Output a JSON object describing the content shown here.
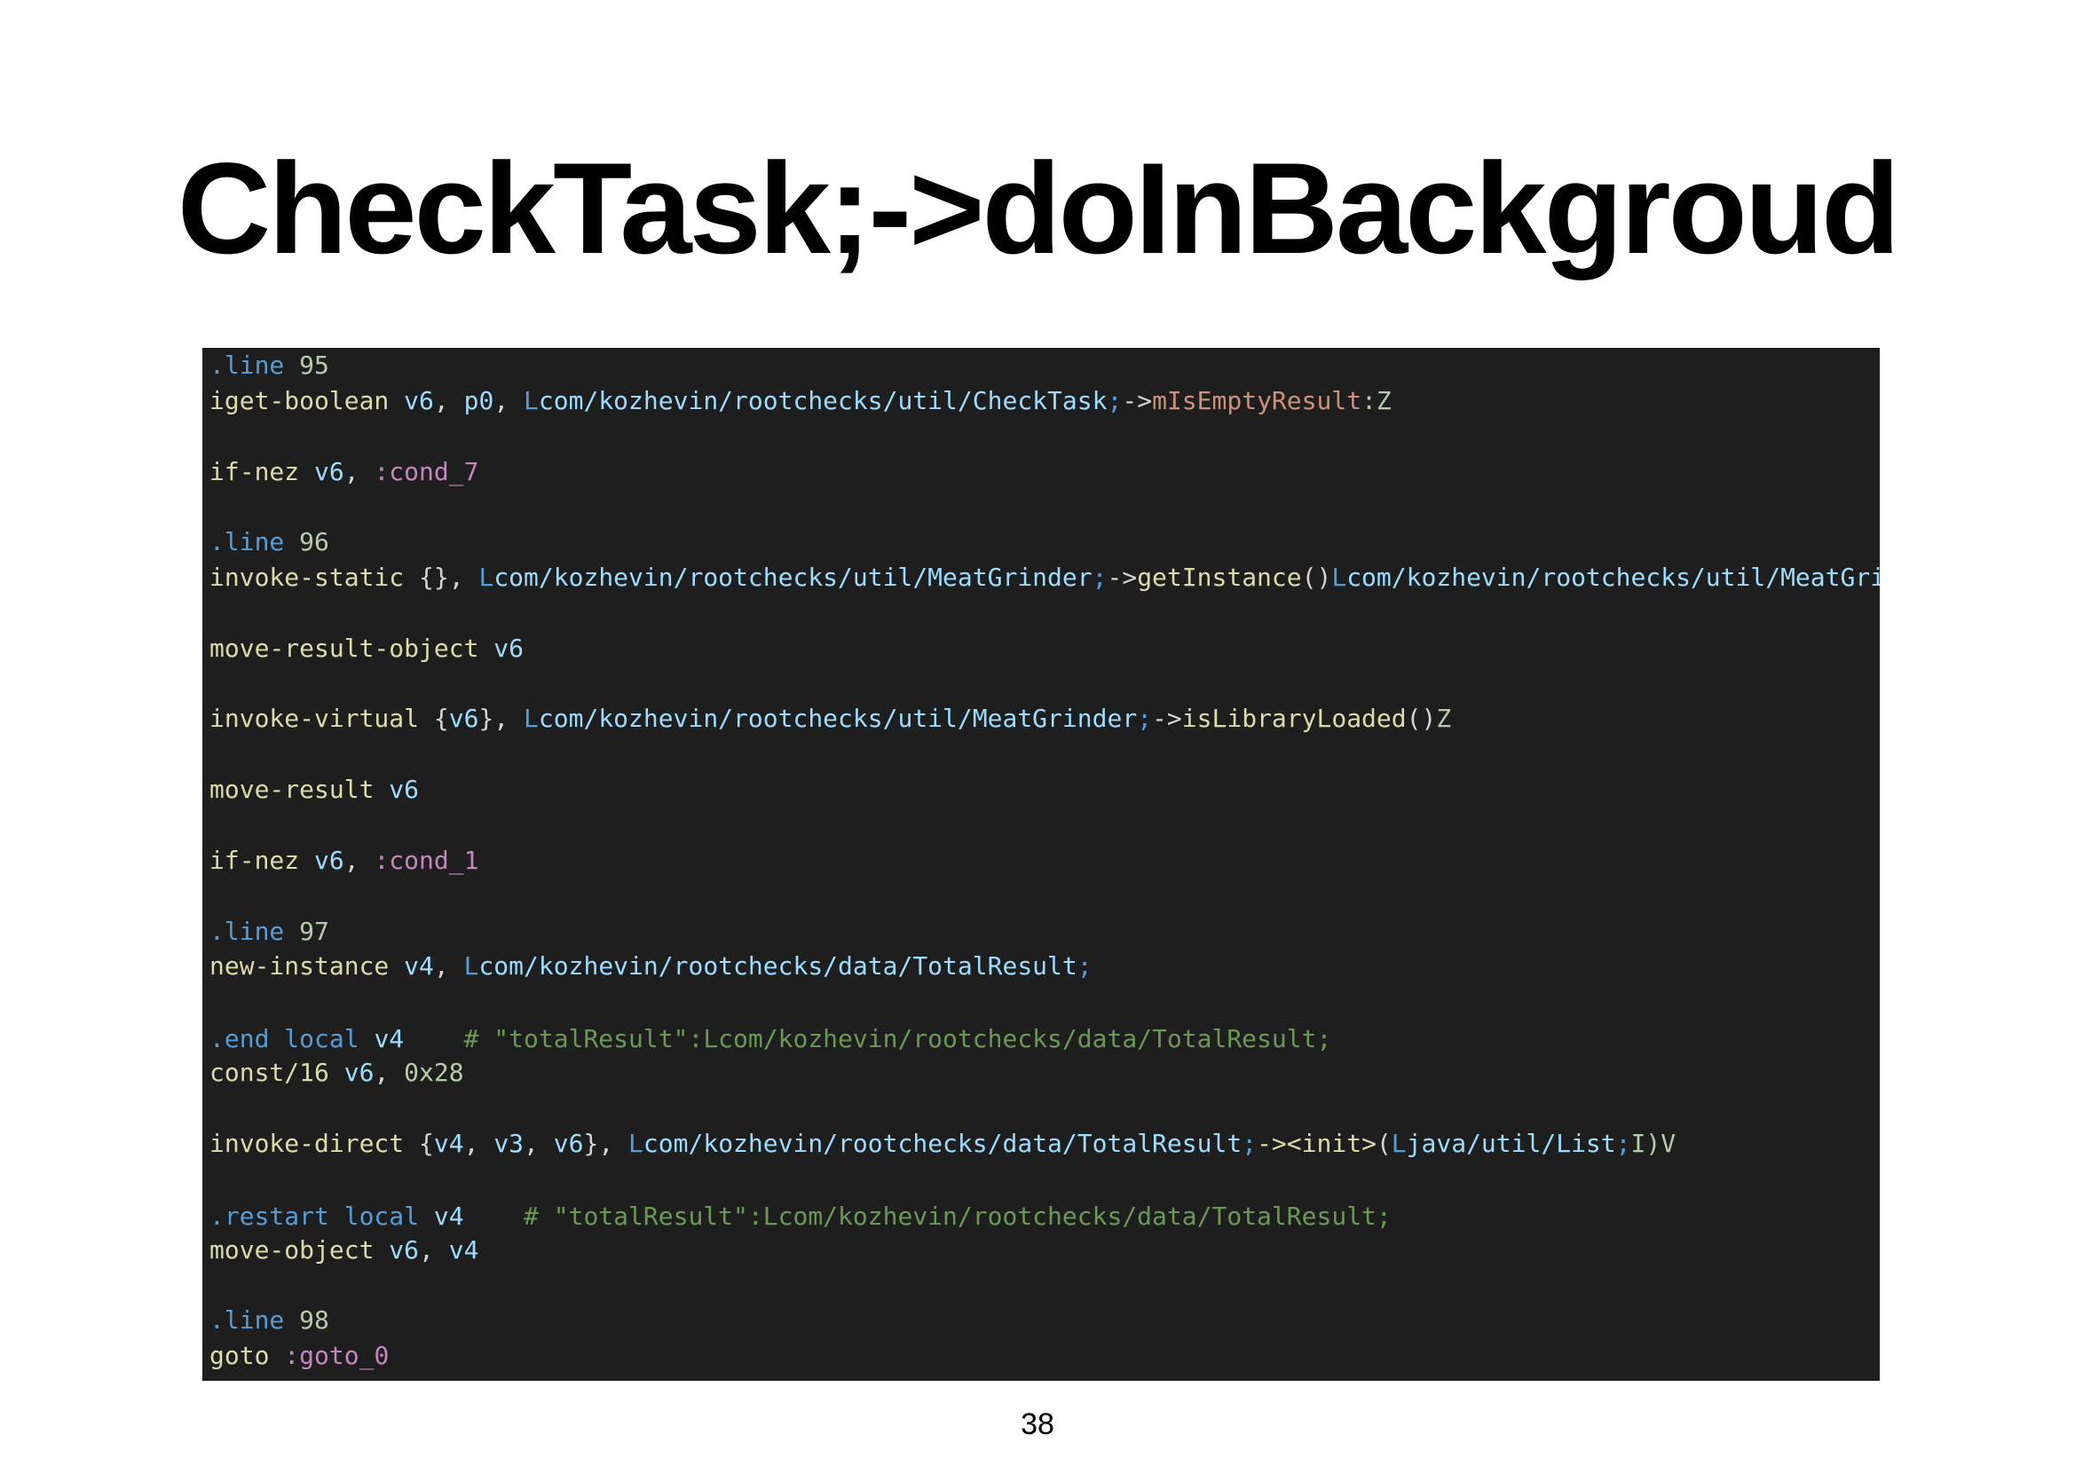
{
  "slide": {
    "title": "CheckTask;->doInBackgroud",
    "page_number": "38"
  },
  "code": {
    "colors": {
      "background": "#1e1e1e",
      "opcode": "#dcdcaa",
      "directive": "#569cd6",
      "register": "#9cdcfe",
      "field": "#ce9178",
      "label": "#c586c0",
      "comment": "#6a9955"
    },
    "lines": [
      [
        {
          "t": ".line",
          "k": "dir"
        },
        {
          "t": " ",
          "k": "punc"
        },
        {
          "t": "95",
          "k": "num"
        }
      ],
      [
        {
          "t": "iget-boolean",
          "k": "op"
        },
        {
          "t": " ",
          "k": "punc"
        },
        {
          "t": "v6",
          "k": "reg"
        },
        {
          "t": ", ",
          "k": "punc"
        },
        {
          "t": "p0",
          "k": "reg"
        },
        {
          "t": ", ",
          "k": "punc"
        },
        {
          "t": "L",
          "k": "type"
        },
        {
          "t": "com/kozhevin/rootchecks/util/CheckTask",
          "k": "path"
        },
        {
          "t": ";",
          "k": "type"
        },
        {
          "t": "->",
          "k": "punc"
        },
        {
          "t": "mIsEmptyResult",
          "k": "field"
        },
        {
          "t": ":Z",
          "k": "num"
        }
      ],
      [
        {
          "t": "if-nez",
          "k": "op"
        },
        {
          "t": " ",
          "k": "punc"
        },
        {
          "t": "v6",
          "k": "reg"
        },
        {
          "t": ", ",
          "k": "punc"
        },
        {
          "t": ":cond_7",
          "k": "label"
        }
      ],
      [
        {
          "t": ".line",
          "k": "dir"
        },
        {
          "t": " ",
          "k": "punc"
        },
        {
          "t": "96",
          "k": "num"
        }
      ],
      [
        {
          "t": "invoke-static",
          "k": "op"
        },
        {
          "t": " {}, ",
          "k": "punc"
        },
        {
          "t": "L",
          "k": "type"
        },
        {
          "t": "com/kozhevin/rootchecks/util/MeatGrinder",
          "k": "path"
        },
        {
          "t": ";",
          "k": "type"
        },
        {
          "t": "->",
          "k": "punc"
        },
        {
          "t": "getInstance",
          "k": "meth"
        },
        {
          "t": "()",
          "k": "punc"
        },
        {
          "t": "L",
          "k": "type"
        },
        {
          "t": "com/kozhevin/rootchecks/util/MeatGrinder",
          "k": "path"
        },
        {
          "t": ";",
          "k": "type"
        }
      ],
      [
        {
          "t": "move-result-object",
          "k": "op"
        },
        {
          "t": " ",
          "k": "punc"
        },
        {
          "t": "v6",
          "k": "reg"
        }
      ],
      [
        {
          "t": "invoke-virtual",
          "k": "op"
        },
        {
          "t": " {",
          "k": "punc"
        },
        {
          "t": "v6",
          "k": "reg"
        },
        {
          "t": "}, ",
          "k": "punc"
        },
        {
          "t": "L",
          "k": "type"
        },
        {
          "t": "com/kozhevin/rootchecks/util/MeatGrinder",
          "k": "path"
        },
        {
          "t": ";",
          "k": "type"
        },
        {
          "t": "->",
          "k": "punc"
        },
        {
          "t": "isLibraryLoaded",
          "k": "meth"
        },
        {
          "t": "()",
          "k": "punc"
        },
        {
          "t": "Z",
          "k": "num"
        }
      ],
      [
        {
          "t": "move-result",
          "k": "op"
        },
        {
          "t": " ",
          "k": "punc"
        },
        {
          "t": "v6",
          "k": "reg"
        }
      ],
      [
        {
          "t": "if-nez",
          "k": "op"
        },
        {
          "t": " ",
          "k": "punc"
        },
        {
          "t": "v6",
          "k": "reg"
        },
        {
          "t": ", ",
          "k": "punc"
        },
        {
          "t": ":cond_1",
          "k": "label"
        }
      ],
      [
        {
          "t": ".line",
          "k": "dir"
        },
        {
          "t": " ",
          "k": "punc"
        },
        {
          "t": "97",
          "k": "num"
        }
      ],
      [
        {
          "t": "new-instance",
          "k": "op"
        },
        {
          "t": " ",
          "k": "punc"
        },
        {
          "t": "v4",
          "k": "reg"
        },
        {
          "t": ", ",
          "k": "punc"
        },
        {
          "t": "L",
          "k": "type"
        },
        {
          "t": "com/kozhevin/rootchecks/data/TotalResult",
          "k": "path"
        },
        {
          "t": ";",
          "k": "type"
        }
      ],
      [
        {
          "t": ".end local",
          "k": "dir"
        },
        {
          "t": " ",
          "k": "punc"
        },
        {
          "t": "v4",
          "k": "reg"
        },
        {
          "t": "    ",
          "k": "punc"
        },
        {
          "t": "# \"totalResult\":Lcom/kozhevin/rootchecks/data/TotalResult;",
          "k": "cmt"
        }
      ],
      [
        {
          "t": "const/16",
          "k": "op"
        },
        {
          "t": " ",
          "k": "punc"
        },
        {
          "t": "v6",
          "k": "reg"
        },
        {
          "t": ", ",
          "k": "punc"
        },
        {
          "t": "0x28",
          "k": "num"
        }
      ],
      [
        {
          "t": "invoke-direct",
          "k": "op"
        },
        {
          "t": " {",
          "k": "punc"
        },
        {
          "t": "v4",
          "k": "reg"
        },
        {
          "t": ", ",
          "k": "punc"
        },
        {
          "t": "v3",
          "k": "reg"
        },
        {
          "t": ", ",
          "k": "punc"
        },
        {
          "t": "v6",
          "k": "reg"
        },
        {
          "t": "}, ",
          "k": "punc"
        },
        {
          "t": "L",
          "k": "type"
        },
        {
          "t": "com/kozhevin/rootchecks/data/TotalResult",
          "k": "path"
        },
        {
          "t": ";",
          "k": "type"
        },
        {
          "t": "-><init>",
          "k": "meth"
        },
        {
          "t": "(",
          "k": "punc"
        },
        {
          "t": "L",
          "k": "type"
        },
        {
          "t": "java/util/List",
          "k": "path"
        },
        {
          "t": ";",
          "k": "type"
        },
        {
          "t": "I)V",
          "k": "num"
        }
      ],
      [
        {
          "t": ".restart local",
          "k": "dir"
        },
        {
          "t": " ",
          "k": "punc"
        },
        {
          "t": "v4",
          "k": "reg"
        },
        {
          "t": "    ",
          "k": "punc"
        },
        {
          "t": "# \"totalResult\":Lcom/kozhevin/rootchecks/data/TotalResult;",
          "k": "cmt"
        }
      ],
      [
        {
          "t": "move-object",
          "k": "op"
        },
        {
          "t": " ",
          "k": "punc"
        },
        {
          "t": "v6",
          "k": "reg"
        },
        {
          "t": ", ",
          "k": "punc"
        },
        {
          "t": "v4",
          "k": "reg"
        }
      ],
      [
        {
          "t": ".line",
          "k": "dir"
        },
        {
          "t": " ",
          "k": "punc"
        },
        {
          "t": "98",
          "k": "num"
        }
      ],
      [
        {
          "t": "goto",
          "k": "op"
        },
        {
          "t": " ",
          "k": "punc"
        },
        {
          "t": ":goto_0",
          "k": "label"
        }
      ]
    ]
  }
}
